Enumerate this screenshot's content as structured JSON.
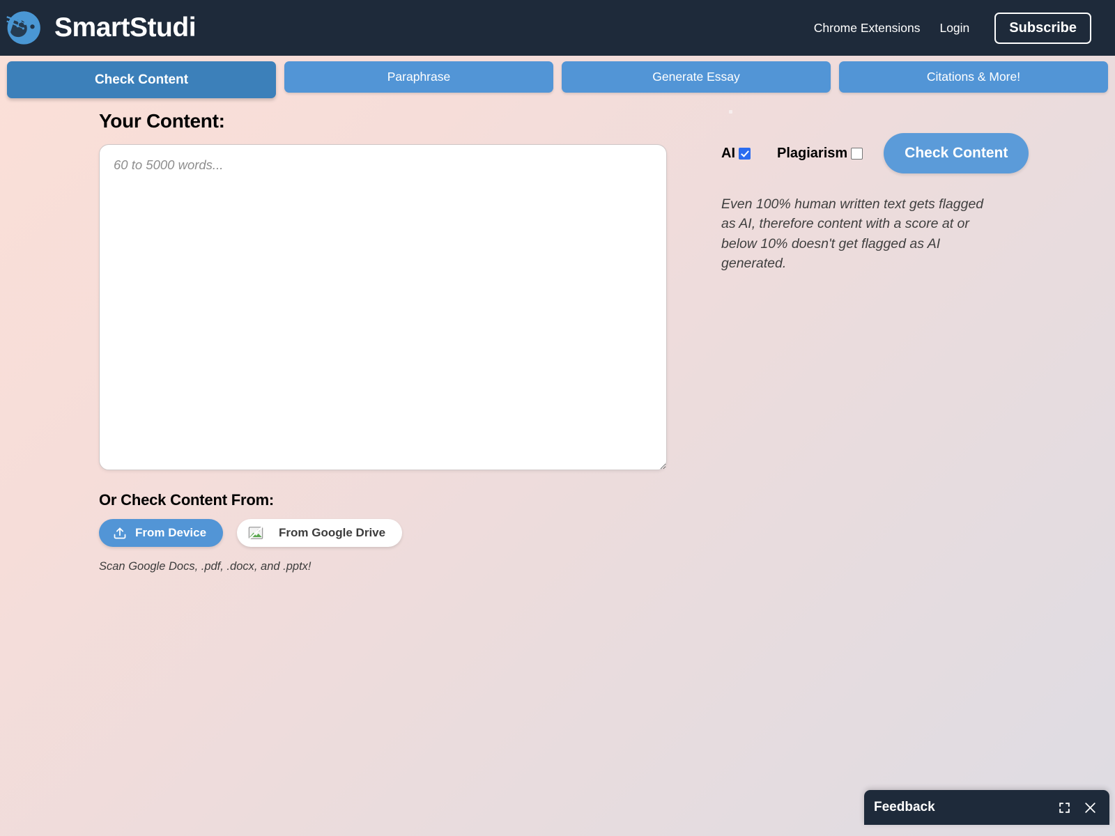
{
  "header": {
    "logo_icon": "brain-head-logo-icon",
    "brand": "SmartStudi",
    "nav": [
      {
        "label": "Chrome Extensions",
        "name": "nav-chrome-extensions"
      },
      {
        "label": "Login",
        "name": "nav-login"
      }
    ],
    "subscribe_label": "Subscribe"
  },
  "tabs": [
    {
      "label": "Check Content",
      "active": true
    },
    {
      "label": "Paraphrase",
      "active": false
    },
    {
      "label": "Generate Essay",
      "active": false
    },
    {
      "label": "Citations & More!",
      "active": false
    }
  ],
  "content": {
    "title": "Your Content:",
    "textarea_value": "",
    "textarea_placeholder": "60 to 5000 words...",
    "source_title": "Or Check Content From:",
    "from_device_label": "From Device",
    "from_device_icon": "upload-icon",
    "from_drive_label": "From Google Drive",
    "from_drive_icon": "broken-image-icon",
    "scan_note": "Scan Google Docs, .pdf, .docx, and .pptx!"
  },
  "options": {
    "stray_dot": ".",
    "ai_label": "AI",
    "ai_checked": true,
    "plagiarism_label": "Plagiarism",
    "plagiarism_checked": false,
    "check_button_label": "Check Content",
    "description": "Even 100% human written text gets flagged as AI, therefore content with a score at or below 10% doesn't get flagged as AI generated."
  },
  "feedback": {
    "title": "Feedback",
    "expand_icon": "expand-icon",
    "close_icon": "close-icon"
  },
  "colors": {
    "header_bg": "#1e2a3a",
    "tab_active": "#3c80ba",
    "tab_inactive": "#5295d6",
    "accent_blue": "#5b9bd9",
    "checkbox_checked": "#2a6cf0",
    "bg_start": "#fbe0d8",
    "bg_end": "#dedce3"
  }
}
